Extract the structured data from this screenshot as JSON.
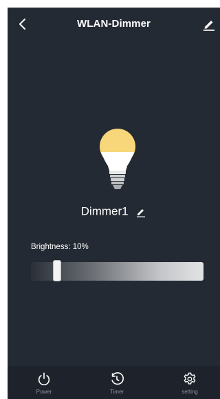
{
  "header": {
    "title": "WLAN-Dimmer",
    "back_icon": "chevron-left-icon",
    "edit_icon": "pencil-icon"
  },
  "device": {
    "name": "Dimmer1",
    "bulb_icon": "light-bulb-icon",
    "bulb_color": "#f7d77a",
    "edit_icon": "pencil-icon"
  },
  "brightness": {
    "label": "Brightness: 10%",
    "value_percent": 10
  },
  "bottom_nav": {
    "tabs": [
      {
        "label": "Power",
        "icon": "power-icon"
      },
      {
        "label": "Timer",
        "icon": "timer-icon"
      },
      {
        "label": "setting",
        "icon": "gear-icon"
      }
    ]
  },
  "colors": {
    "background": "#242a33",
    "bottom_bar": "#1e232b",
    "text": "#ffffff",
    "muted_text": "#8c9098"
  }
}
